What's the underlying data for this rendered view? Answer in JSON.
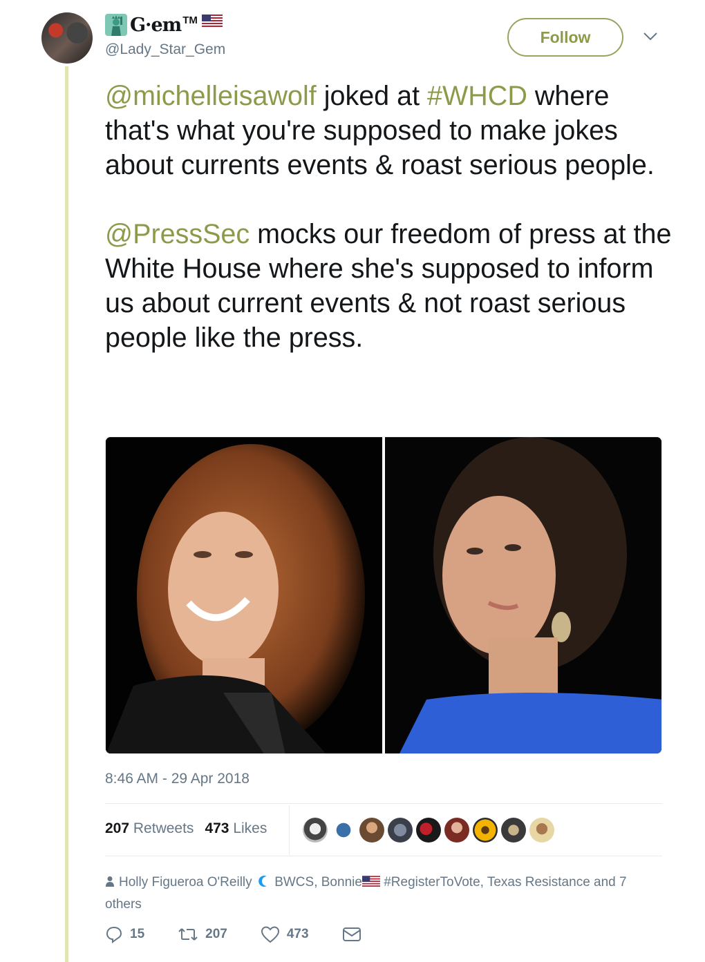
{
  "user": {
    "display_name": "G·em",
    "trademark": "TM",
    "handle": "@Lady_Star_Gem"
  },
  "follow_label": "Follow",
  "tweet": {
    "p1_mention": "@michelleisawolf",
    "p1_a": " joked at ",
    "p1_hashtag": "#WHCD",
    "p1_b": " where that's what you're supposed to make jokes about currents events & roast serious people.",
    "p2_mention": "@PressSec",
    "p2_a": " mocks our freedom of press at the White House where she's supposed to inform us about current events & not roast serious people like the press."
  },
  "timestamp": "8:46 AM - 29 Apr 2018",
  "stats": {
    "retweets_count": "207",
    "retweets_label": "Retweets",
    "likes_count": "473",
    "likes_label": "Likes"
  },
  "liked_by": {
    "name1": "Holly Figueroa O'Reilly",
    "name2": "BWCS, Bonnie",
    "name3": "#RegisterToVote, Texas Resistance and 7 others"
  },
  "actions": {
    "reply_count": "15",
    "retweet_count": "207",
    "like_count": "473"
  },
  "colors": {
    "accent": "#8e9a49",
    "thread_line": "#e1e4b3",
    "secondary_text": "#657786"
  }
}
